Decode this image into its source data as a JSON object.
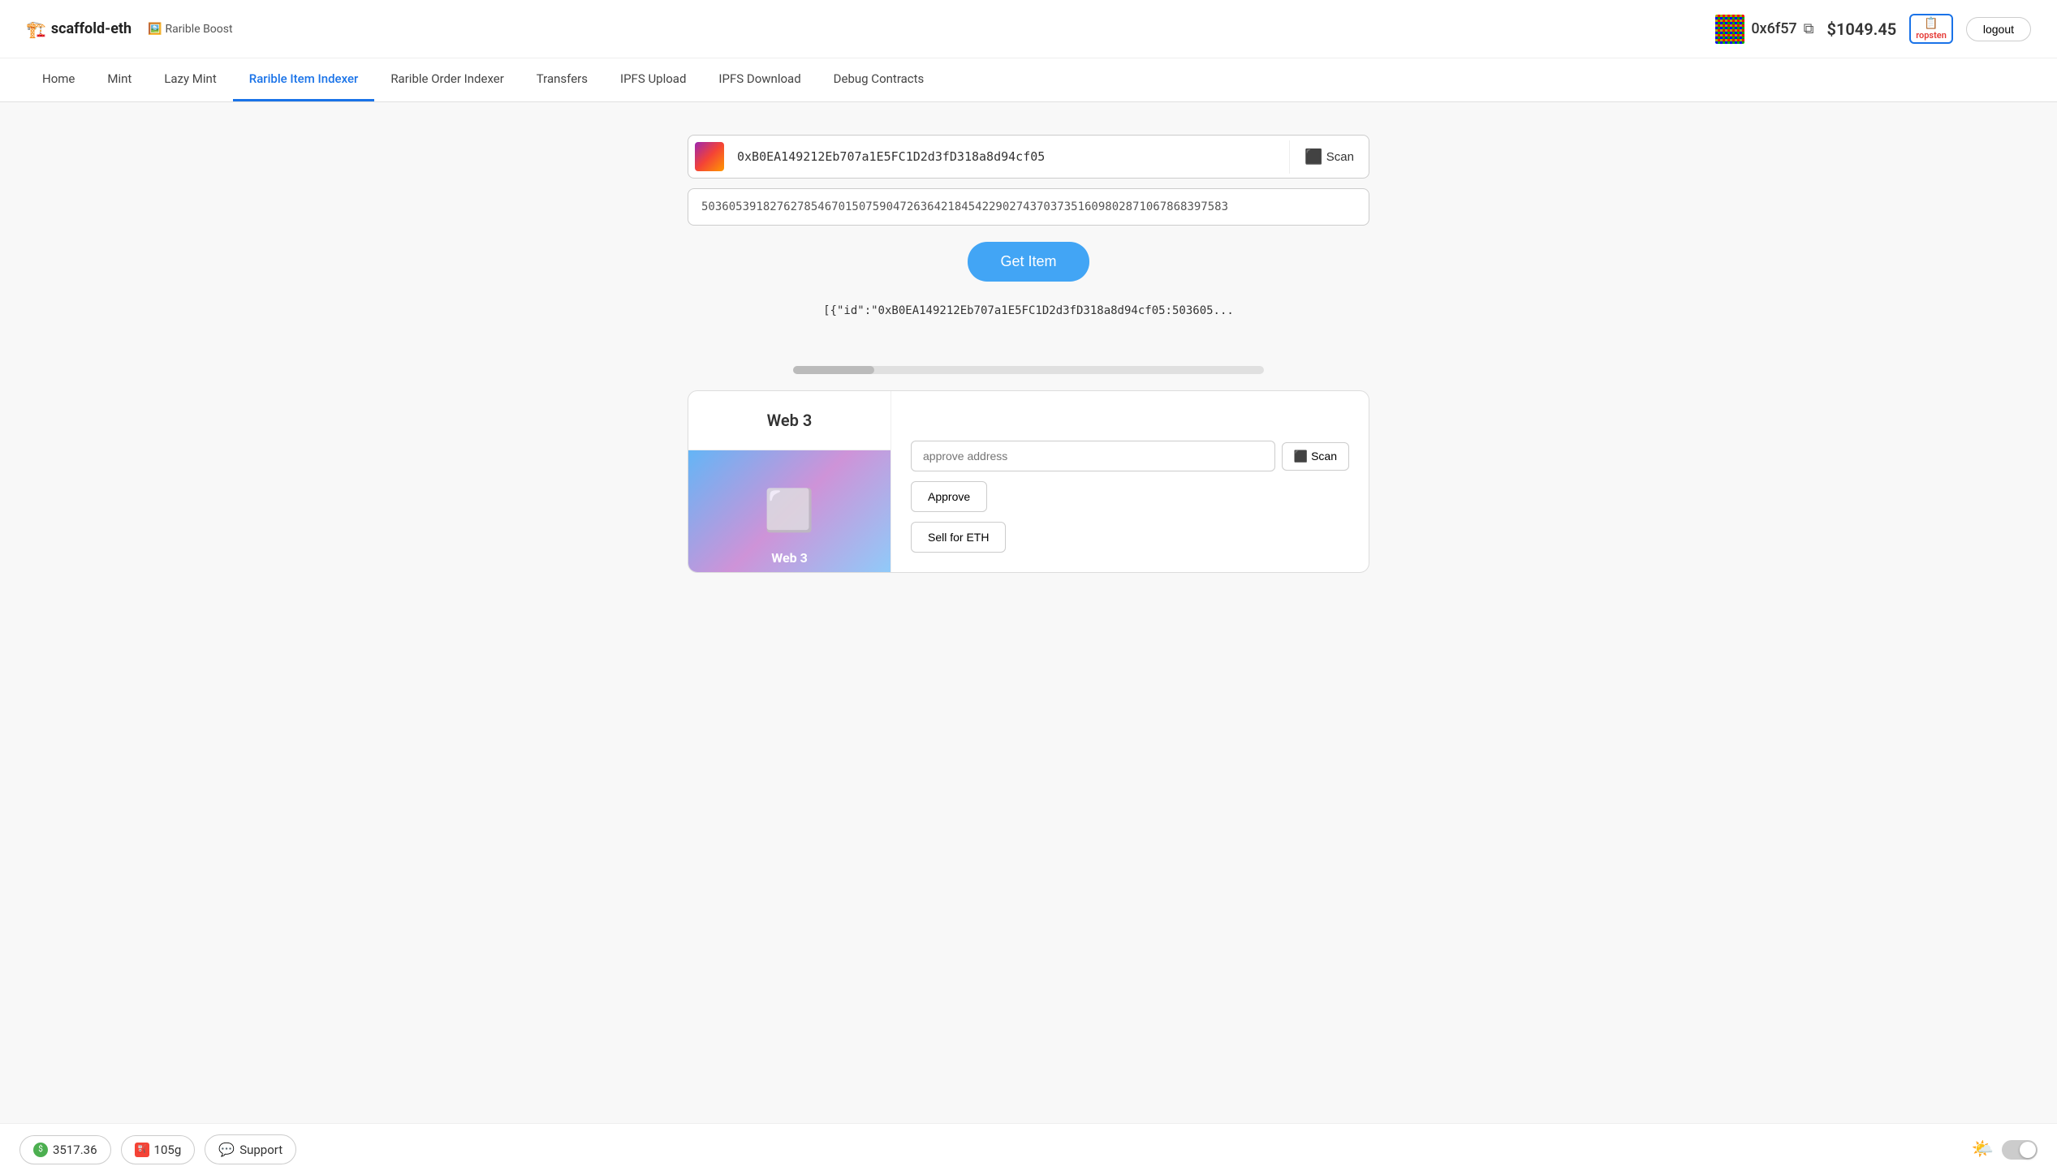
{
  "app": {
    "title": "scaffold-eth",
    "title_icon": "🏗️",
    "subtitle": "Rarible Boost",
    "subtitle_icon": "🖼️"
  },
  "header": {
    "wallet_address": "0x6f57",
    "balance": "$1049.45",
    "network": "ropsten",
    "network_icon": "📋",
    "logout_label": "logout"
  },
  "nav": {
    "items": [
      {
        "label": "Home",
        "active": false
      },
      {
        "label": "Mint",
        "active": false
      },
      {
        "label": "Lazy Mint",
        "active": false
      },
      {
        "label": "Rarible Item Indexer",
        "active": true
      },
      {
        "label": "Rarible Order Indexer",
        "active": false
      },
      {
        "label": "Transfers",
        "active": false
      },
      {
        "label": "IPFS Upload",
        "active": false
      },
      {
        "label": "IPFS Download",
        "active": false
      },
      {
        "label": "Debug Contracts",
        "active": false
      }
    ]
  },
  "main": {
    "address_value": "0xB0EA149212Eb707a1E5FC1D2d3fD318a8d94cf05",
    "address_placeholder": "0xB0EA149212Eb707a1E5FC1D2d3fD318a8d94cf05",
    "token_id_value": "50360539182762785467015075904726364218454229027437037351609802871067868397583",
    "token_id_placeholder": "50360539182762785467015075904726364218454229027437037351609802871067868397583",
    "scan_label": "Scan",
    "get_item_label": "Get Item",
    "result_text": "[{\"id\":\"0xB0EA149212Eb707a1E5FC1D2d3fD318a8d94cf05:503605..."
  },
  "card": {
    "title": "Web 3",
    "image_label": "Web 3",
    "approve_placeholder": "approve address",
    "approve_scan_label": "Scan",
    "approve_label": "Approve",
    "sell_label": "Sell for ETH"
  },
  "bottom": {
    "balance_label": "3517.36",
    "gas_label": "105g",
    "support_label": "Support",
    "sun_icon": "🌤️"
  }
}
